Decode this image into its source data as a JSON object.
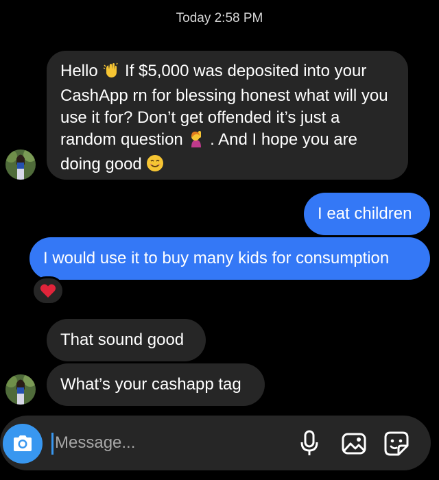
{
  "thread": {
    "timestamp": "Today 2:58 PM"
  },
  "messages": {
    "m1": {
      "part1": "Hello",
      "part2": " If $5,000 was deposited into your CashApp rn for blessing honest what will you use it for? Don’t get offended it’s just a random question",
      "part3": ". And I hope you are doing good",
      "emoji_a": "waving-hand-icon",
      "emoji_b": "raising-hand-woman-icon",
      "emoji_c": "smiling-face-icon"
    },
    "m2": {
      "text": "I eat children"
    },
    "m3": {
      "text": "I would use it to buy many kids for consumption",
      "reaction": "red-heart-icon"
    },
    "m4": {
      "text": "That sound good"
    },
    "m5": {
      "text": "What’s your cashapp tag"
    }
  },
  "composer": {
    "placeholder": "Message...",
    "value": "",
    "icons": [
      "camera-icon",
      "microphone-icon",
      "gallery-icon",
      "sticker-icon"
    ]
  },
  "colors": {
    "background": "#000000",
    "incoming_bubble": "#262626",
    "outgoing_bubble": "#3478f6",
    "accent": "#3897f0",
    "heart": "#e0243a"
  }
}
